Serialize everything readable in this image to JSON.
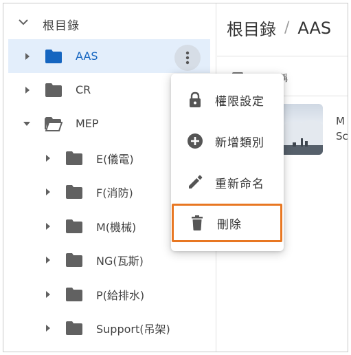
{
  "tree": {
    "root_label": "根目錄",
    "items": [
      {
        "label": "AAS",
        "state": "collapsed",
        "selected": true
      },
      {
        "label": "CR",
        "state": "collapsed"
      },
      {
        "label": "MEP",
        "state": "expanded"
      },
      {
        "label": "E(儀電)",
        "state": "collapsed"
      },
      {
        "label": "F(消防)",
        "state": "collapsed"
      },
      {
        "label": "M(機械)",
        "state": "collapsed"
      },
      {
        "label": "NG(瓦斯)",
        "state": "collapsed"
      },
      {
        "label": "P(給排水)",
        "state": "collapsed"
      },
      {
        "label": "Support(吊架)",
        "state": "collapsed"
      }
    ]
  },
  "header": {
    "crumb_root": "根目錄",
    "separator": "/",
    "crumb_current": "AAS"
  },
  "list": {
    "column_name_partial": "稱",
    "file_text_line1": "M",
    "file_text_line2": "Sc"
  },
  "context_menu": {
    "items": [
      {
        "label": "權限設定",
        "icon": "lock-icon"
      },
      {
        "label": "新增類別",
        "icon": "add-circle-icon"
      },
      {
        "label": "重新命名",
        "icon": "pencil-icon"
      },
      {
        "label": "刪除",
        "icon": "trash-icon",
        "highlighted": true
      }
    ]
  },
  "colors": {
    "folder_selected": "#1565c0",
    "folder": "#616161",
    "selection_bg": "#e3eefb",
    "highlight_border": "#e87722"
  }
}
